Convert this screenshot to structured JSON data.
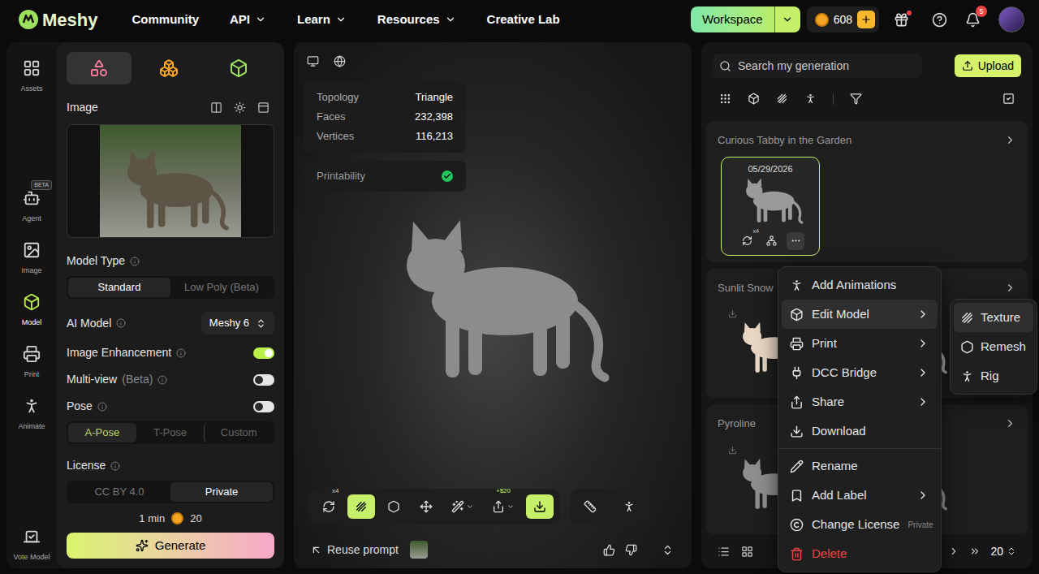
{
  "nav": {
    "logo": "Meshy",
    "links": [
      {
        "label": "Community",
        "dropdown": false
      },
      {
        "label": "API",
        "dropdown": true
      },
      {
        "label": "Learn",
        "dropdown": true
      },
      {
        "label": "Resources",
        "dropdown": true
      },
      {
        "label": "Creative Lab",
        "dropdown": false
      }
    ],
    "workspace": "Workspace",
    "credits": "608",
    "gift_dot": true,
    "notifications": "5"
  },
  "rail": [
    {
      "label": "Assets",
      "selected": false,
      "badge": ""
    },
    {
      "label": "Agent",
      "selected": false,
      "badge": "BETA"
    },
    {
      "label": "Image",
      "selected": false,
      "badge": ""
    },
    {
      "label": "Model",
      "selected": true,
      "badge": ""
    },
    {
      "label": "Print",
      "selected": false,
      "badge": ""
    },
    {
      "label": "Animate",
      "selected": false,
      "badge": ""
    }
  ],
  "rail_bottom": {
    "label": "Vote Model"
  },
  "panel": {
    "mode_tabs": [
      {
        "selected": true
      },
      {
        "selected": false
      },
      {
        "selected": false
      }
    ],
    "image_section": {
      "title": "Image"
    },
    "model_type": {
      "label": "Model Type",
      "options": [
        {
          "label": "Standard",
          "selected": true
        },
        {
          "label": "Low Poly (Beta)",
          "selected": false
        }
      ]
    },
    "ai_model": {
      "label": "AI Model",
      "value": "Meshy 6"
    },
    "toggles": [
      {
        "label": "Image Enhancement",
        "tag": "",
        "on": true
      },
      {
        "label": "Multi-view",
        "tag": "(Beta)",
        "on": false
      },
      {
        "label": "Pose",
        "tag": "",
        "on": false
      }
    ],
    "pose_options": [
      {
        "label": "A-Pose",
        "selected": true
      },
      {
        "label": "T-Pose",
        "selected": false
      },
      {
        "label": "Custom",
        "selected": false
      }
    ],
    "license": {
      "label": "License",
      "options": [
        {
          "label": "CC BY 4.0",
          "selected": false
        },
        {
          "label": "Private",
          "selected": true
        }
      ]
    },
    "footer": {
      "time": "1 min",
      "cost": "20",
      "generate": "Generate"
    }
  },
  "viewport": {
    "stats": [
      {
        "label": "Topology",
        "value": "Triangle"
      },
      {
        "label": "Faces",
        "value": "232,398"
      },
      {
        "label": "Vertices",
        "value": "116,213"
      }
    ],
    "printability": {
      "label": "Printability",
      "ok": true
    },
    "toolbar": [
      {
        "badge": "x4",
        "active": false,
        "dropdown": false
      },
      {
        "badge": "",
        "active": true,
        "dropdown": false
      },
      {
        "badge": "",
        "active": false,
        "dropdown": false
      },
      {
        "badge": "",
        "active": false,
        "dropdown": false
      },
      {
        "badge": "",
        "active": false,
        "dropdown": true
      },
      {
        "badge": "+$20",
        "active": false,
        "dropdown": true
      },
      {
        "badge": "",
        "active": true,
        "dropdown": false
      }
    ],
    "toolbar2": [
      {
        "badge": "",
        "active": false,
        "dropdown": false
      },
      {
        "badge": "",
        "active": false,
        "dropdown": false
      }
    ],
    "reuse": "Reuse prompt"
  },
  "library": {
    "search": "Search my generation",
    "upload": "Upload",
    "groups": [
      {
        "title": "Curious Tabby in the Garden",
        "cards": [
          {
            "date": "05/29/2026",
            "badge": "x4",
            "selected": true
          }
        ]
      },
      {
        "title": "Sunlit Snow",
        "cards": [
          {
            "date": "",
            "badge": "",
            "selected": false
          },
          {
            "date": "",
            "badge": "",
            "selected": false
          }
        ]
      },
      {
        "title": "Pyroline",
        "cards": [
          {
            "date": "",
            "badge": "",
            "selected": false
          },
          {
            "date": "",
            "badge": "",
            "selected": false
          }
        ]
      }
    ],
    "page_size": "20"
  },
  "menu": {
    "items": [
      {
        "label": "Add Animations",
        "submenu": false,
        "hint": "",
        "highlighted": false,
        "danger": false,
        "divider_before": false
      },
      {
        "label": "Edit Model",
        "submenu": true,
        "hint": "",
        "highlighted": true,
        "danger": false,
        "divider_before": false
      },
      {
        "label": "Print",
        "submenu": true,
        "hint": "",
        "highlighted": false,
        "danger": false,
        "divider_before": false
      },
      {
        "label": "DCC Bridge",
        "submenu": true,
        "hint": "",
        "highlighted": false,
        "danger": false,
        "divider_before": false
      },
      {
        "label": "Share",
        "submenu": true,
        "hint": "",
        "highlighted": false,
        "danger": false,
        "divider_before": false
      },
      {
        "label": "Download",
        "submenu": false,
        "hint": "",
        "highlighted": false,
        "danger": false,
        "divider_before": false
      },
      {
        "label": "Rename",
        "submenu": false,
        "hint": "",
        "highlighted": false,
        "danger": false,
        "divider_before": true
      },
      {
        "label": "Add Label",
        "submenu": true,
        "hint": "",
        "highlighted": false,
        "danger": false,
        "divider_before": false
      },
      {
        "label": "Change License",
        "submenu": false,
        "hint": "Private",
        "highlighted": false,
        "danger": false,
        "divider_before": false
      },
      {
        "label": "Delete",
        "submenu": false,
        "hint": "",
        "highlighted": false,
        "danger": true,
        "divider_before": false
      }
    ],
    "submenu": [
      {
        "label": "Texture",
        "highlighted": true
      },
      {
        "label": "Remesh",
        "highlighted": false
      },
      {
        "label": "Rig",
        "highlighted": false
      }
    ]
  }
}
